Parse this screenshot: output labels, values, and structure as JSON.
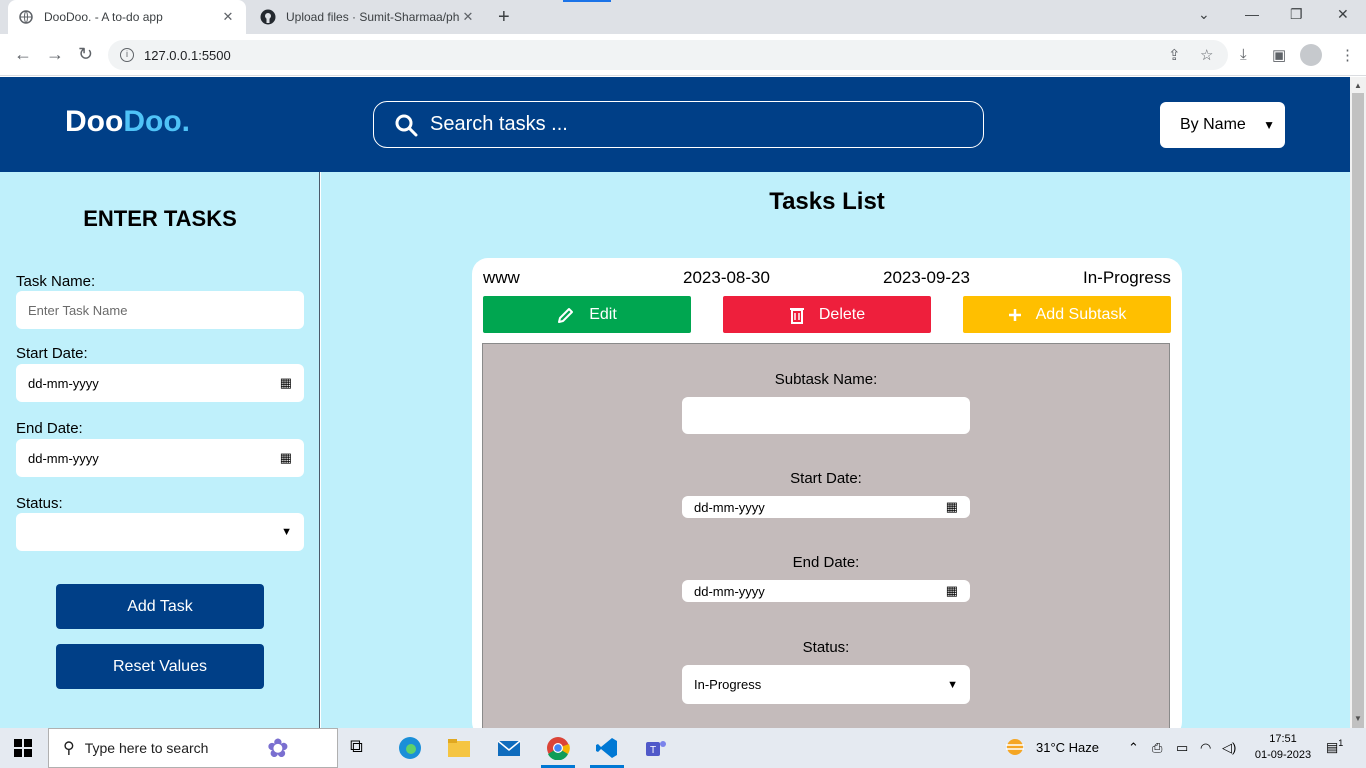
{
  "browser": {
    "tabs": [
      {
        "title": "DooDoo. - A to-do app",
        "active": true
      },
      {
        "title": "Upload files · Sumit-Sharmaa/pha",
        "active": false
      }
    ],
    "url": "127.0.0.1:5500"
  },
  "header": {
    "logo_part1": "Doo",
    "logo_part2": "Doo.",
    "search_placeholder": "Search tasks ...",
    "sort_selected": "By Name"
  },
  "enter_form": {
    "title": "ENTER TASKS",
    "task_name_label": "Task Name:",
    "task_name_placeholder": "Enter Task Name",
    "start_date_label": "Start Date:",
    "start_date_value": "dd-mm-yyyy",
    "end_date_label": "End Date:",
    "end_date_value": "dd-mm-yyyy",
    "status_label": "Status:",
    "status_value": "",
    "add_task_label": "Add Task",
    "reset_label": "Reset Values"
  },
  "tasks_list": {
    "title": "Tasks List",
    "task": {
      "name": "www",
      "start_date": "2023-08-30",
      "end_date": "2023-09-23",
      "status": "In-Progress",
      "edit_label": "Edit",
      "delete_label": "Delete",
      "add_subtask_label": "Add Subtask",
      "edit_color": "#00a650",
      "delete_color": "#ee1f3c",
      "add_subtask_color": "#ffbf00"
    },
    "subtask_form": {
      "name_label": "Subtask Name:",
      "name_value": "",
      "start_date_label": "Start Date:",
      "start_date_value": "dd-mm-yyyy",
      "end_date_label": "End Date:",
      "end_date_value": "dd-mm-yyyy",
      "status_label": "Status:",
      "status_value": "In-Progress"
    }
  },
  "taskbar": {
    "search_placeholder": "Type here to search",
    "weather": "31°C  Haze",
    "time": "17:51",
    "date": "01-09-2023",
    "notification_count": "1"
  }
}
